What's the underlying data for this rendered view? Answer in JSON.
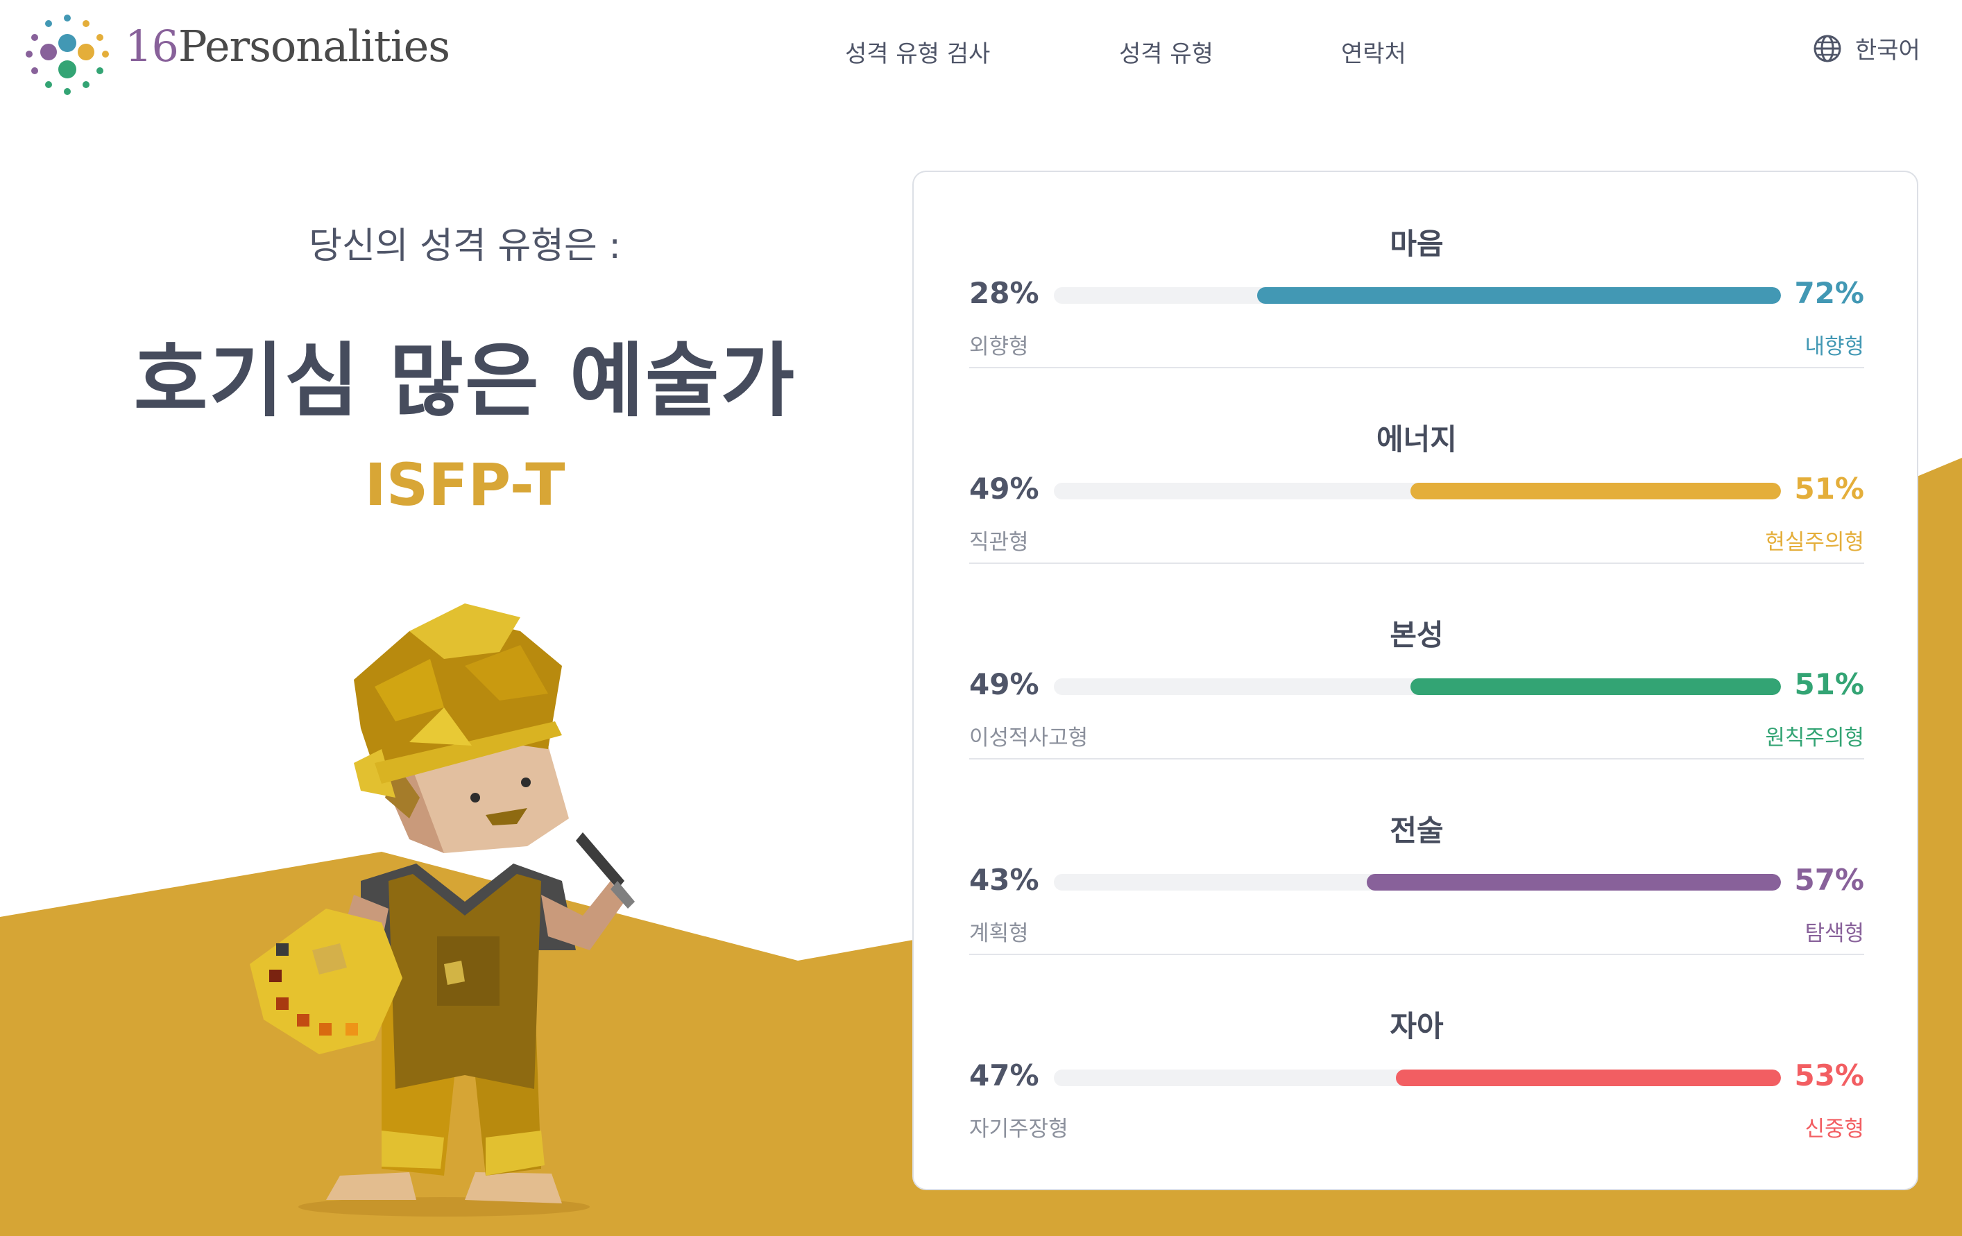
{
  "brand": {
    "number": "16",
    "name": "Personalities"
  },
  "nav": [
    {
      "label": "성격 유형 검사"
    },
    {
      "label": "성격 유형"
    },
    {
      "label": "연락처"
    }
  ],
  "language": {
    "label": "한국어",
    "icon": "globe-icon"
  },
  "hero": {
    "subtitle": "당신의 성격 유형은 :",
    "title": "호기심 많은 예술가",
    "code": "ISFP-T"
  },
  "illustration": {
    "icon": "artist-illustration",
    "background_color": "#d6a535"
  },
  "traits": [
    {
      "name": "마음",
      "left_pct": "28%",
      "right_pct": "72%",
      "left_label": "외향형",
      "right_label": "내향형",
      "right_value": 72,
      "color": "#4298b4"
    },
    {
      "name": "에너지",
      "left_pct": "49%",
      "right_pct": "51%",
      "left_label": "직관형",
      "right_label": "현실주의형",
      "right_value": 51,
      "color": "#e4ae3a"
    },
    {
      "name": "본성",
      "left_pct": "49%",
      "right_pct": "51%",
      "left_label": "이성적사고형",
      "right_label": "원칙주의형",
      "right_value": 51,
      "color": "#33a474"
    },
    {
      "name": "전술",
      "left_pct": "43%",
      "right_pct": "57%",
      "left_label": "계획형",
      "right_label": "탐색형",
      "right_value": 57,
      "color": "#88619a"
    },
    {
      "name": "자아",
      "left_pct": "47%",
      "right_pct": "53%",
      "left_label": "자기주장형",
      "right_label": "신중형",
      "right_value": 53,
      "color": "#f25e62"
    }
  ]
}
